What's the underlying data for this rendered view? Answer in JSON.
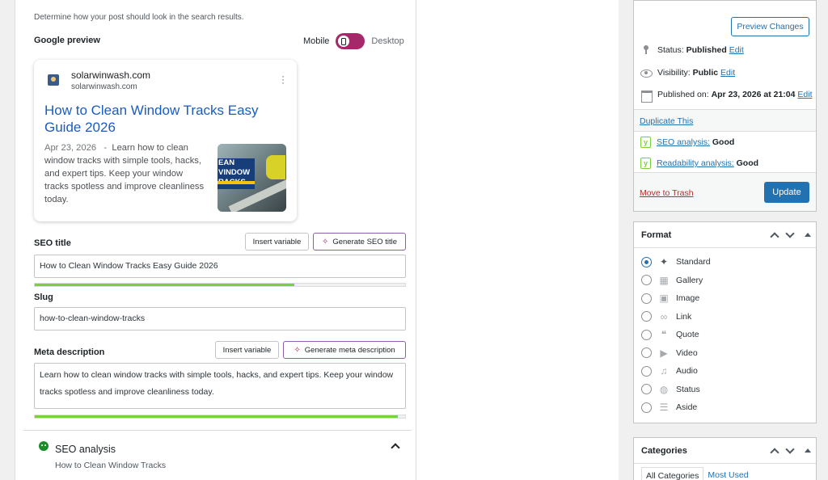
{
  "seo_editor": {
    "search_description": "Determine how your post should look in the search results.",
    "google_preview_label": "Google preview",
    "mode_mobile": "Mobile",
    "mode_desktop": "Desktop",
    "preview_card": {
      "site_name": "solarwinwash.com",
      "site_url": "solarwinwash.com",
      "title": "How to Clean Window Tracks Easy Guide 2026",
      "date": "Apr 23, 2026",
      "separator": "-",
      "description": "Learn how to clean window tracks with simple tools, hacks, and expert tips. Keep your window tracks spotless and improve cleanliness today.",
      "thumb_line1": "EAN",
      "thumb_line2": "VINDOW",
      "thumb_line3": "RACKS"
    },
    "seo_title": {
      "label": "SEO title",
      "insert_variable": "Insert variable",
      "generate": "Generate SEO title",
      "value": "How to Clean Window Tracks Easy Guide 2026",
      "progress": 0.7,
      "progress_color": "#7ad03a"
    },
    "slug": {
      "label": "Slug",
      "value": "how-to-clean-window-tracks"
    },
    "meta_description": {
      "label": "Meta description",
      "insert_variable": "Insert variable",
      "generate": "Generate meta description",
      "value": "Learn how to clean window tracks with simple tools, hacks, and expert tips. Keep your window tracks spotless and improve cleanliness today.",
      "progress": 0.98,
      "progress_color": "#7ad03a"
    },
    "seo_analysis": {
      "title": "SEO analysis",
      "subtitle": "How to Clean Window Tracks",
      "status_color": "#1e8c2b"
    }
  },
  "publish_box": {
    "preview_button": "Preview Changes",
    "status_label": "Status:",
    "status_value": "Published",
    "visibility_label": "Visibility:",
    "visibility_value": "Public",
    "published_label": "Published on:",
    "published_value": "Apr 23, 2026 at 21:04",
    "edit": "Edit",
    "duplicate": "Duplicate This",
    "seo_analysis_link": "SEO analysis:",
    "seo_analysis_value": "Good",
    "readability_link": "Readability analysis:",
    "readability_value": "Good",
    "trash": "Move to Trash",
    "update": "Update",
    "accent": "#2271b1"
  },
  "format_box": {
    "title": "Format",
    "selected": "Standard",
    "items": [
      {
        "label": "Standard",
        "icon": "pin-icon"
      },
      {
        "label": "Gallery",
        "icon": "gallery-icon"
      },
      {
        "label": "Image",
        "icon": "image-icon"
      },
      {
        "label": "Link",
        "icon": "link-icon"
      },
      {
        "label": "Quote",
        "icon": "quote-icon"
      },
      {
        "label": "Video",
        "icon": "video-icon"
      },
      {
        "label": "Audio",
        "icon": "audio-icon"
      },
      {
        "label": "Status",
        "icon": "status-icon"
      },
      {
        "label": "Aside",
        "icon": "aside-icon"
      }
    ]
  },
  "categories_box": {
    "title": "Categories",
    "tab_all": "All Categories",
    "tab_most_used": "Most Used"
  }
}
